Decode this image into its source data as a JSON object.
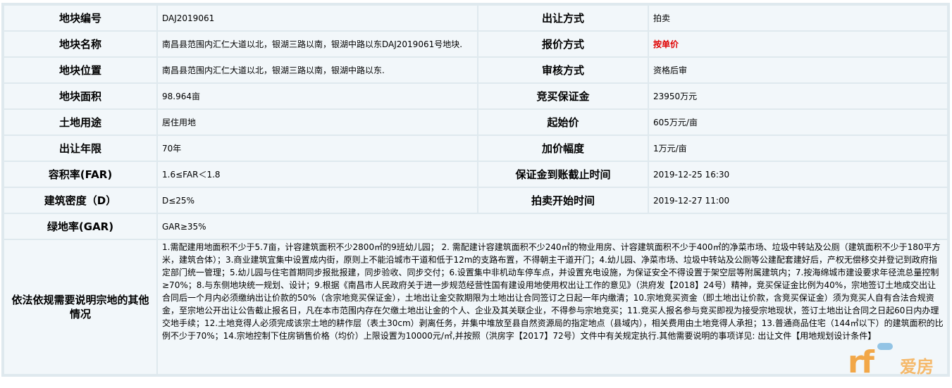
{
  "rows": [
    {
      "label": "地块编号",
      "value": "DAJ2019061",
      "label2": "出让方式",
      "value2": "拍卖"
    },
    {
      "label": "地块名称",
      "value": "南昌县范围内汇仁大道以北，银湖三路以南，银湖中路以东DAJ2019061号地块.",
      "label2": "报价方式",
      "value2": "按单价"
    },
    {
      "label": "地块位置",
      "value": "南昌县范围内汇仁大道以北，银湖三路以南，银湖中路以东.",
      "label2": "审核方式",
      "value2": "资格后审"
    },
    {
      "label": "地块面积",
      "value": "98.964亩",
      "label2": "竞买保证金",
      "value2": "23950万元"
    },
    {
      "label": "土地用途",
      "value": "居住用地",
      "label2": "起始价",
      "value2": "605万元/亩"
    },
    {
      "label": "出让年限",
      "value": "70年",
      "label2": "加价幅度",
      "value2": "1万元/亩"
    },
    {
      "label": "容积率(FAR)",
      "value": "1.6≤FAR＜1.8",
      "label2": "保证金到账截止时间",
      "value2": "2019-12-25 16:30"
    },
    {
      "label": "建筑密度（D）",
      "value": "D≤25%",
      "label2": "拍卖开始时间",
      "value2": "2019-12-27 11:00"
    }
  ],
  "green_rate": {
    "label": "绿地率(GAR)",
    "value": "GAR≥35%"
  },
  "notes": {
    "label": "依法依规需要说明宗地的其他情况",
    "text": "1.需配建用地面积不少于5.7亩，计容建筑面积不少2800㎡的9班幼儿园； 2. 需配建计容建筑面积不少240㎡的物业用房、计容建筑面积不少于400㎡的净菜市场、垃圾中转站及公厕（建筑面积不少于180平方米，建筑合体）；3.商业建筑宜集中设置成内街，原则上不能沿城市干道和低于12m的支路布置，不得朝主干道开门；4.幼儿园、净菜市场、垃圾中转站及公厕等公建配套建好后，产权无偿移交并登记到政府指定部门统一管理；5.幼儿园与住宅首期同步报批报建，同步验收、同步交付；6.设置集中非机动车停车点，并设置充电设施，为保证安全不得设置于架空层等附属建筑内；7.按海绵城市建设要求年径流总量控制≥70%；8.与东侧地块统一规划、设计；9.根据《南昌市人民政府关于进一步规范经营性国有建设用地使用权出让工作的意见》（洪府发【2018】24号）精神，竞买保证金比例为40%，宗地签订土地成交出让合同后一个月内必须缴纳出让价款的50%（含宗地竞买保证金），土地出让金交款期限为土地出让合同签订之日起一年内缴清；10.宗地竞买资金（即土地出让价款，含竞买保证金）须为竞买人自有合法合规资金，至宗地公开出让公告截止报名日，凡在本市范围内存在欠缴土地出让金的个人、企业及其关联企业，不得参与宗地竞买；11.竞买人报名参与竞买即视为接受宗地现状，签订土地出让合同之日起60日内办理交地手续；12.土地竞得人必须完成该宗土地的耕作层（表土30cm）剥离任务，并集中堆放至县自然资源局的指定地点（县域内），相关费用由土地竞得人承担；13.普通商品住宅（144㎡以下）的建筑面积的比例不少于70%；14.宗地控制下住房销售价格（均价）上限设置为10000元/㎡,并按照（洪房字【2017】72号）文件中有关规定执行.其他需要说明的事项详见: 出让文件【用地规划设计条件】"
  },
  "watermark": {
    "text": "爱房",
    "mark": "rf"
  },
  "colors": {
    "frame": "#dfe9ee",
    "cell": "#f2f7fa",
    "accent_red": "#e00000"
  }
}
